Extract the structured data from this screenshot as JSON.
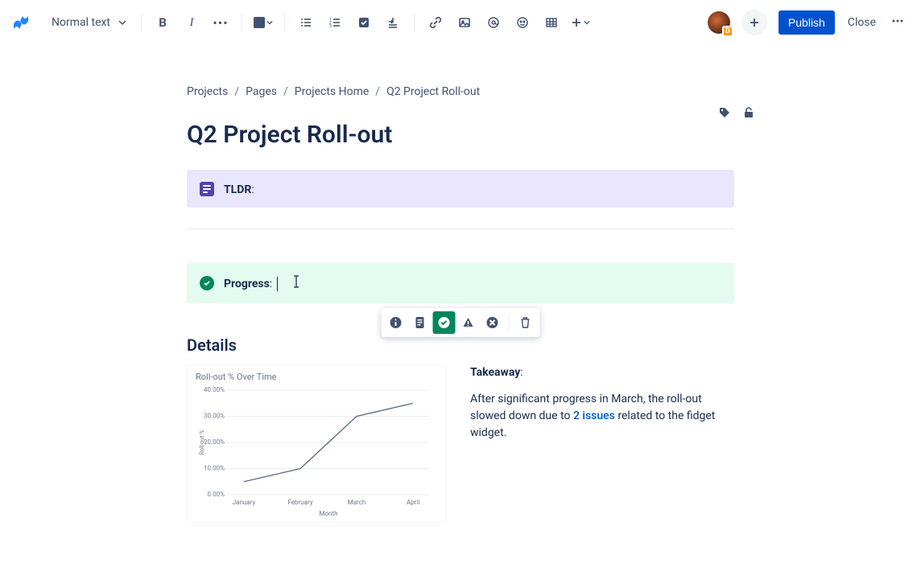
{
  "toolbar": {
    "text_style": "Normal text",
    "publish": "Publish",
    "close": "Close"
  },
  "avatar_badge": "D",
  "breadcrumbs": [
    "Projects",
    "Pages",
    "Projects Home",
    "Q2 Project Roll-out"
  ],
  "page_title": "Q2 Project Roll-out",
  "panels": {
    "tldr_label": "TLDR",
    "progress_label": "Progress"
  },
  "details": {
    "heading": "Details",
    "takeaway_label": "Takeaway",
    "takeaway_text_1": "After significant progress in March, the roll-out slowed down due to ",
    "takeaway_link": "2 issues",
    "takeaway_text_2": " related to the fidget widget."
  },
  "chart_data": {
    "type": "line",
    "title": "Roll-out % Over Time",
    "xlabel": "Month",
    "ylabel": "Roll-out %",
    "categories": [
      "January",
      "February",
      "March",
      "April"
    ],
    "y_ticks": [
      0,
      10,
      20,
      30,
      40
    ],
    "y_tick_labels": [
      "0.00%",
      "10.00%",
      "20.00%",
      "30.00%",
      "40.00%"
    ],
    "values": [
      5,
      10,
      30,
      35
    ],
    "ylim": [
      0,
      40
    ]
  }
}
